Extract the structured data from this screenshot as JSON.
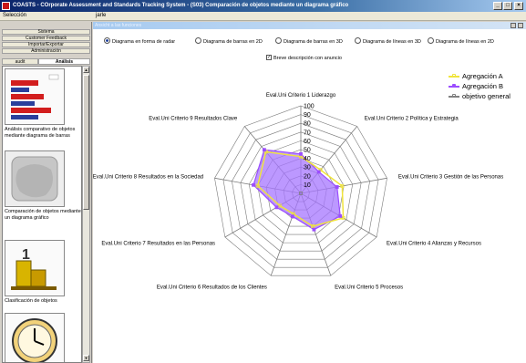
{
  "window": {
    "title": "COASTS - COrporate Assessment and Standards Tracking System - (S03) Comparación de objetos mediante un diagrama gráfico",
    "minimize": "_",
    "maximize": "□",
    "close": "×"
  },
  "menubar": {
    "left": "Selección",
    "right": "jarle"
  },
  "sidebar": {
    "tabs": [
      "Sistema",
      "Customer Feedback",
      "Importar/Exportar",
      "Administración"
    ],
    "subtabs": [
      "audit",
      "Análisis"
    ],
    "tools": [
      {
        "label": "Análisis comparativo de objetos mediante diagrama de barras",
        "icon": "bar-chart-icon"
      },
      {
        "label": "Comparación de objetos mediante un diagrama gráfico",
        "icon": "radar-chart-icon"
      },
      {
        "label": "Clasificación de objetos",
        "icon": "ranking-icon"
      },
      {
        "label": "",
        "icon": "clock-icon"
      }
    ]
  },
  "main": {
    "panel_title": "Ansicht a las funciones",
    "chart_options": [
      {
        "label": "Diagrama en forma de radar",
        "selected": true
      },
      {
        "label": "Diagrama de barras en 2D",
        "selected": false
      },
      {
        "label": "Diagrama de barras en 3D",
        "selected": false
      },
      {
        "label": "Diagrama de líneas en 3D",
        "selected": false
      },
      {
        "label": "Diagrama de líneas en 2D",
        "selected": false
      }
    ],
    "checkbox": {
      "label": "Breve descripción con anuncio",
      "checked": true,
      "mark": "✓"
    }
  },
  "colors": {
    "series_a": "#f0e43c",
    "series_b": "#9b4dff",
    "fill_b": "#a675ff",
    "objective": "#808080",
    "grid": "#7a7a7a"
  },
  "chart_data": {
    "type": "radar",
    "axes": [
      "Eval.Uni Criterio 1 Liderazgo",
      "Eval.Uni Criterio 2 Política y Estrategia",
      "Eval.Uni Criterio 3 Gestión de las Personas",
      "Eval.Uni Criterio 4 Alianzas y Recursos",
      "Eval.Uni Criterio 5 Procesos",
      "Eval.Uni Criterio 6 Resultados de los Clientes",
      "Eval.Uni Criterio 7 Resultados en las Personas",
      "Eval.Uni Criterio 8 Resultados en la Sociedad",
      "Eval.Uni Criterio 9 Resultados Clave"
    ],
    "range": [
      0,
      100
    ],
    "ticks": [
      "10",
      "20",
      "30",
      "40",
      "50",
      "60",
      "70",
      "80",
      "90",
      "100"
    ],
    "series": [
      {
        "name": "Agregación A",
        "values": [
          42,
          35,
          48,
          56,
          40,
          25,
          28,
          50,
          62
        ]
      },
      {
        "name": "Agregación B",
        "values": [
          45,
          32,
          42,
          52,
          44,
          28,
          32,
          55,
          65
        ]
      },
      {
        "name": "objetivo general",
        "values": [
          0,
          0,
          0,
          0,
          0,
          0,
          0,
          0,
          0
        ]
      }
    ],
    "legend": "top-right"
  }
}
